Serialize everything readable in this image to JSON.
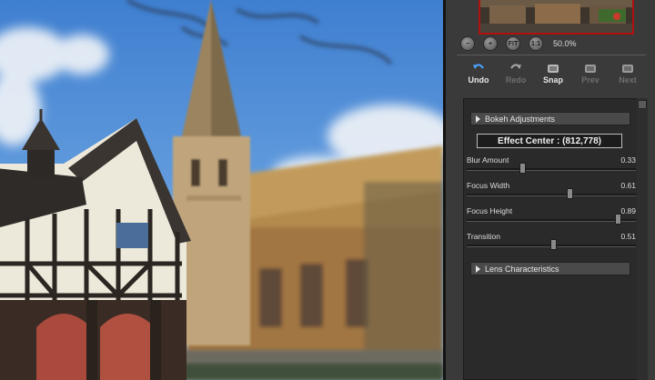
{
  "canvas": {
    "preview_image": "blurred-church-photo"
  },
  "navigator": {
    "zoom_buttons": [
      {
        "icon": "zoom-out-icon",
        "glyph": "−"
      },
      {
        "icon": "zoom-in-icon",
        "glyph": "+"
      },
      {
        "icon": "fit-icon",
        "glyph": "FIT"
      },
      {
        "icon": "actual-size-icon",
        "glyph": "1:1"
      }
    ],
    "zoom_value": "50.0%"
  },
  "toolbar": {
    "undo": "Undo",
    "redo": "Redo",
    "snap": "Snap",
    "prev": "Prev",
    "next": "Next"
  },
  "bokeh": {
    "title": "Bokeh Adjustments",
    "effect_center": "Effect Center : (812,778)",
    "sliders": [
      {
        "label": "Blur Amount",
        "value": "0.33",
        "level": 0.33
      },
      {
        "label": "Focus Width",
        "value": "0.61",
        "level": 0.61
      },
      {
        "label": "Focus Height",
        "value": "0.89",
        "level": 0.89
      },
      {
        "label": "Transition",
        "value": "0.51",
        "level": 0.51
      }
    ]
  },
  "lens": {
    "title": "Lens Characteristics"
  },
  "colors": {
    "panel": "#3a3a3a",
    "accent_red": "#b01010",
    "sky": "#4d8fd6"
  }
}
